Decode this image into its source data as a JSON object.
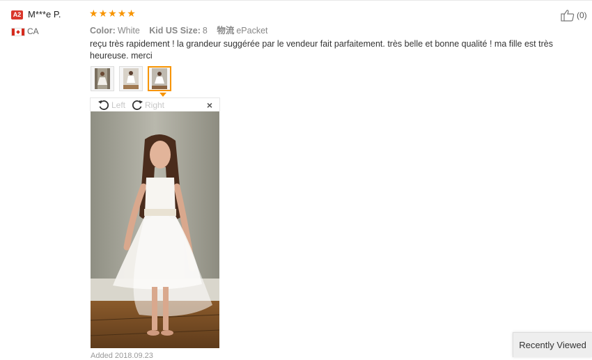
{
  "reviewer": {
    "level_badge": "A2",
    "name": "M***e P.",
    "country": "CA"
  },
  "rating": {
    "stars": 5
  },
  "attributes": {
    "color_key": "Color:",
    "color_value": "White",
    "size_key": "Kid US Size:",
    "size_value": "8",
    "shipping_key": "物流",
    "shipping_value": "ePacket"
  },
  "review_text": "reçu très rapidement ! la grandeur suggérée par le vendeur fait parfaitement. très belle et bonne qualité ! ma fille est très heureuse. merci",
  "thumbnails": {
    "count": 3,
    "active_index": 2
  },
  "viewer": {
    "rotate_left_label": "Left",
    "rotate_right_label": "Right",
    "close_label": "×"
  },
  "bottom_text": "Added 2018.09.23",
  "like": {
    "count": "(0)"
  },
  "recently_viewed_label": "Recently Viewed",
  "colors": {
    "accent_orange": "#f79400",
    "badge_red": "#d9372b"
  },
  "icons": [
    "user-level-badge",
    "canada-flag-icon",
    "star-icon",
    "thumbs-up-icon",
    "rotate-left-icon",
    "rotate-right-icon",
    "close-icon"
  ]
}
